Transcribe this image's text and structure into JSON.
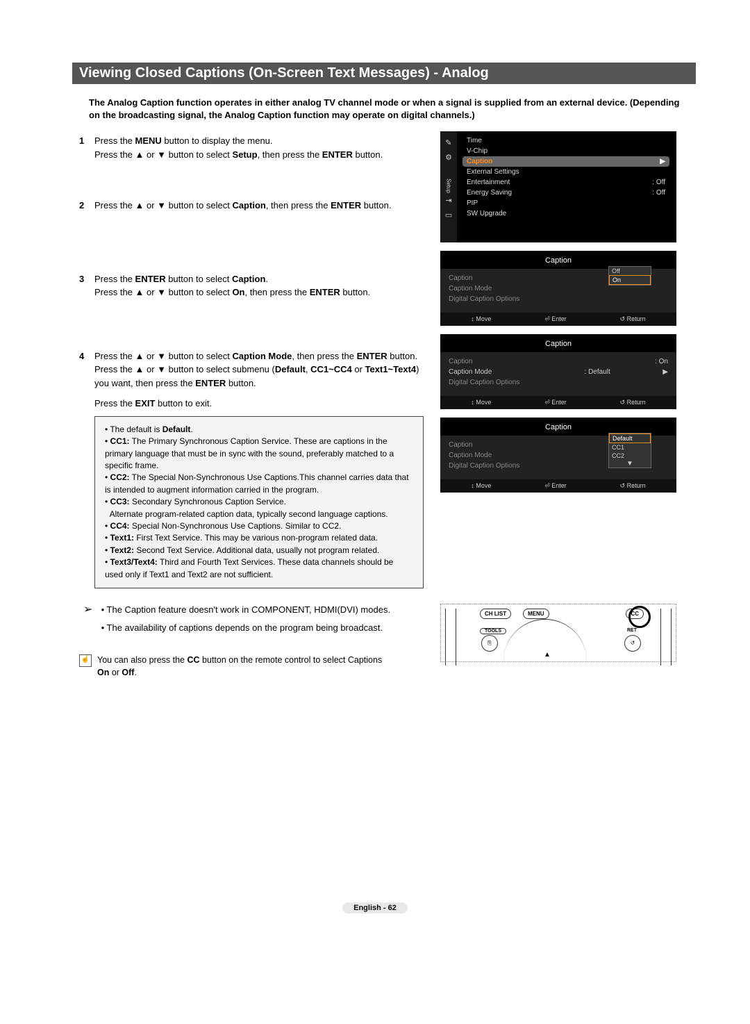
{
  "title": "Viewing Closed Captions (On-Screen Text Messages) - Analog",
  "intro": "The Analog Caption function operates in either analog TV channel mode or when a signal is supplied from an external device. (Depending on the broadcasting signal, the Analog Caption function may operate on digital channels.)",
  "steps": {
    "s1num": "1",
    "s1a": "Press the ",
    "s1b": "MENU",
    "s1c": " button to display the menu.",
    "s1d": "Press the ▲ or ▼ button to select ",
    "s1e": "Setup",
    "s1f": ", then press the ",
    "s1g": "ENTER",
    "s1h": " button.",
    "s2num": "2",
    "s2a": "Press the ▲ or ▼ button to select ",
    "s2b": "Caption",
    "s2c": ", then press the ",
    "s2d": "ENTER",
    "s2e": " button.",
    "s3num": "3",
    "s3a": "Press the ",
    "s3b": "ENTER",
    "s3c": " button to select ",
    "s3d": "Caption",
    "s3e": ".",
    "s3f": "Press the ▲ or ▼ button to select ",
    "s3g": "On",
    "s3h": ", then press the ",
    "s3i": "ENTER",
    "s3j": " button.",
    "s4num": "4",
    "s4a": "Press the ▲ or ▼ button to select ",
    "s4b": "Caption Mode",
    "s4c": ", then press the ",
    "s4d": "ENTER",
    "s4e": "button. Press the ▲ or ▼ button to select submenu (",
    "s4f": "Default",
    "s4g": ", ",
    "s4h": "CC1~CC4",
    "s4i": " or",
    "s4j": "Text1~Text4",
    "s4k": ") you want, then press the ",
    "s4l": "ENTER",
    "s4m": " button.",
    "s4n": "Press the ",
    "s4o": "EXIT",
    "s4p": " button to exit."
  },
  "bullets": {
    "b0a": "The default is ",
    "b0b": "Default",
    "b0c": ".",
    "b1a": "CC1:",
    "b1b": " The Primary Synchronous Caption Service. These are captions in the primary language that must be in sync with the sound, preferably matched to a specific frame.",
    "b2a": "CC2:",
    "b2b": " The Special Non-Synchronous Use Captions.This channel carries data that is intended to augment information carried in the program.",
    "b3a": "CC3:",
    "b3b": " Secondary Synchronous Caption Service.",
    "b3c": "Alternate program-related caption data, typically second language captions.",
    "b4a": "CC4:",
    "b4b": " Special Non-Synchronous Use Captions. Similar to CC2.",
    "b5a": "Text1:",
    "b5b": " First Text Service. This may be various non-program related data.",
    "b6a": "Text2:",
    "b6b": " Second Text Service. Additional data, usually not program related.",
    "b7a": "Text3/Text4:",
    "b7b": " Third and Fourth Text Services. These data channels should be used only if Text1 and Text2 are not sufficient."
  },
  "notes": {
    "n1": "The Caption feature doesn't work in COMPONENT, HDMI(DVI) modes.",
    "n2": "The availability of captions depends on the program being broadcast.",
    "r1": "You can also press the ",
    "r2": "CC",
    "r3": " button on the remote control to select Captions ",
    "r4": "On",
    "r5": " or ",
    "r6": "Off",
    "r7": "."
  },
  "osd": {
    "setup": {
      "sidebar_label": "Setup",
      "rows": [
        {
          "label": "Time",
          "val": ""
        },
        {
          "label": "V-Chip",
          "val": ""
        },
        {
          "label": "Caption",
          "val": "▶",
          "hl": true
        },
        {
          "label": "External Settings",
          "val": ""
        },
        {
          "label": "Entertainment",
          "val": ": Off"
        },
        {
          "label": "Energy Saving",
          "val": ": Off"
        },
        {
          "label": "PIP",
          "val": ""
        },
        {
          "label": "SW Upgrade",
          "val": ""
        }
      ]
    },
    "caption1": {
      "title": "Caption",
      "items": [
        {
          "lbl": "Caption",
          "val": ""
        },
        {
          "lbl": "Caption Mode",
          "val": ""
        },
        {
          "lbl": "Digital Caption Options",
          "val": ""
        }
      ],
      "popup": [
        "Off",
        "On"
      ],
      "popup_sel": 1
    },
    "caption2": {
      "title": "Caption",
      "items": [
        {
          "lbl": "Caption",
          "val": ": On"
        },
        {
          "lbl": "Caption Mode",
          "val": ": Default",
          "chev": "▶",
          "active": true
        },
        {
          "lbl": "Digital Caption Options",
          "val": ""
        }
      ]
    },
    "caption3": {
      "title": "Caption",
      "items": [
        {
          "lbl": "Caption",
          "val": ""
        },
        {
          "lbl": "Caption Mode",
          "val": ""
        },
        {
          "lbl": "Digital Caption Options",
          "val": ""
        }
      ],
      "popup": [
        "Default",
        "CC1",
        "CC2"
      ],
      "popup_sel": 0,
      "popup_more": "▼"
    },
    "footer": {
      "move": "↕ Move",
      "enter": "⏎ Enter",
      "ret": "↺ Return"
    }
  },
  "remote": {
    "chlist": "CH LIST",
    "menu": "MENU",
    "cc": "CC",
    "tools": "TOOLS",
    "ret": "RET"
  },
  "footer": "English - 62"
}
